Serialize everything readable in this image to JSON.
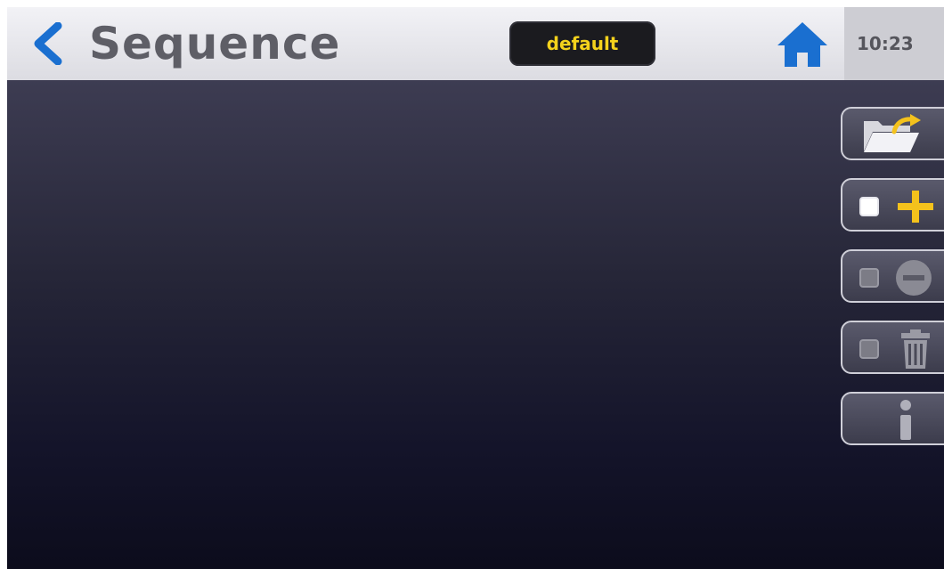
{
  "header": {
    "title": "Sequence",
    "profile": "default",
    "time": "10:23"
  },
  "icons": {
    "back": "chevron-left-icon",
    "home": "home-icon",
    "open": "folder-open-icon",
    "add": "add-icon",
    "remove": "remove-icon",
    "delete": "trash-icon",
    "info": "info-icon"
  },
  "colors": {
    "accent_blue": "#1a6fd0",
    "accent_yellow": "#f4c21c",
    "profile_text": "#f4d21c"
  }
}
